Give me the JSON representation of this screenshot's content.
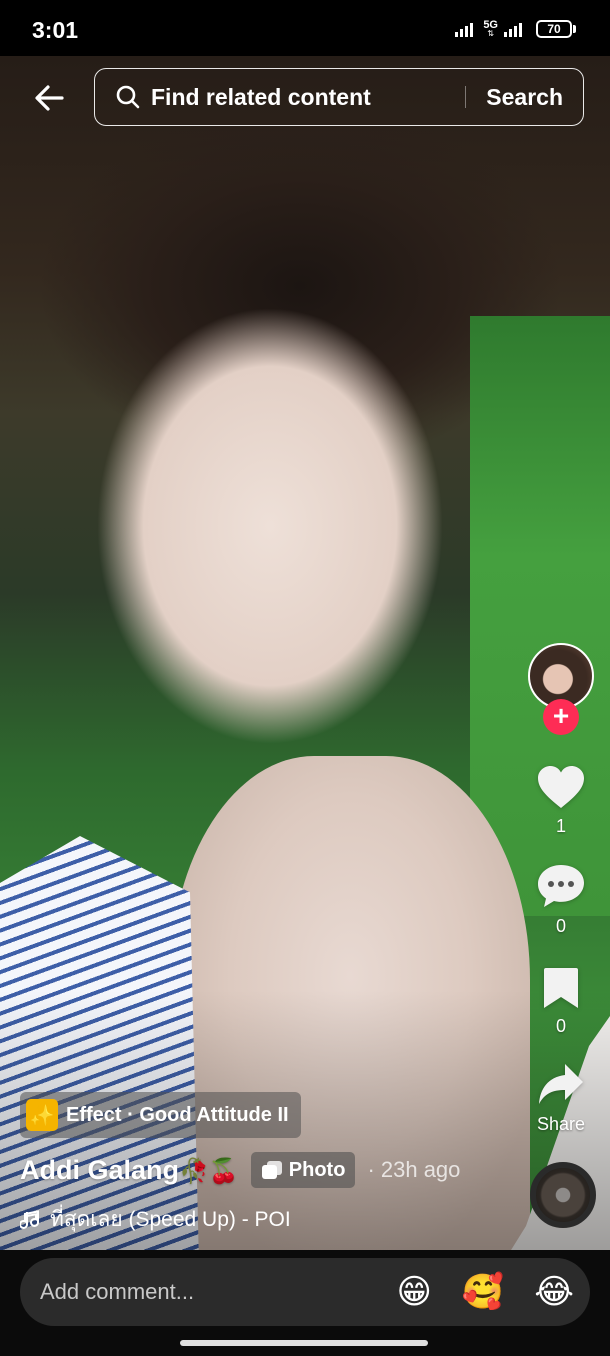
{
  "status_bar": {
    "time": "3:01",
    "network": "5G",
    "battery": "70"
  },
  "top_bar": {
    "search_placeholder": "Find related content",
    "search_button": "Search"
  },
  "post": {
    "effect_label": "Effect · Good Attitude II",
    "author_name": "Addi Galang",
    "author_emoji": "🥀🍒",
    "type_badge": "Photo",
    "time_ago": "· 23h ago",
    "music": "ที่สุดเลย (Speed Up) - POI"
  },
  "actions": {
    "likes": "1",
    "comments": "0",
    "saves": "0",
    "share_label": "Share",
    "follow_symbol": "+"
  },
  "comment_bar": {
    "placeholder": "Add comment...",
    "quick_emojis": [
      "😁",
      "🥰",
      "😂"
    ]
  },
  "colors": {
    "follow_badge": "#fe2c55",
    "effect_icon_bg": "#f5b400"
  }
}
